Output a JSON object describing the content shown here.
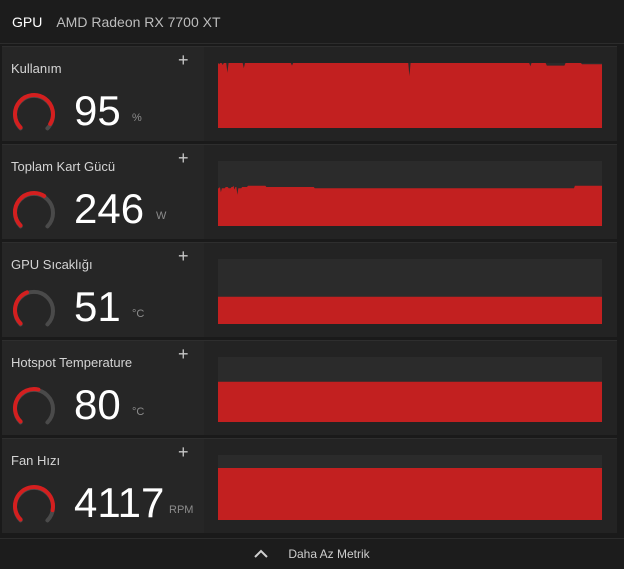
{
  "header": {
    "tab_label": "GPU",
    "device_name": "AMD Radeon RX 7700 XT"
  },
  "colors": {
    "accent": "#d41f1f",
    "graph_fill": "#c22020",
    "gauge_track": "#4a4a4a"
  },
  "metrics": [
    {
      "name": "Kullanım",
      "value": "95",
      "unit": "%",
      "gauge_fraction": 0.95,
      "history": [
        100,
        98,
        100,
        100,
        97,
        100,
        100,
        100,
        85,
        100,
        100,
        100,
        100,
        100,
        100,
        100,
        100,
        100,
        100,
        100,
        100,
        100,
        92,
        100,
        100,
        100,
        100,
        100,
        100,
        100,
        100,
        100,
        100,
        100,
        100,
        100,
        100,
        100,
        100,
        100,
        100,
        100,
        100,
        100,
        100,
        100,
        100,
        100,
        100,
        100,
        100,
        100,
        100,
        100,
        100,
        100,
        100,
        100,
        100,
        100,
        100,
        100,
        100,
        96,
        100,
        100,
        100,
        100,
        100,
        100,
        100,
        100,
        100,
        100,
        100,
        100,
        100,
        100,
        100,
        100,
        100,
        100,
        100,
        100,
        100,
        100,
        100,
        100,
        100,
        100,
        100,
        100,
        100,
        100,
        100,
        100,
        100,
        100,
        100,
        100,
        100,
        100,
        100,
        100,
        100,
        100,
        100,
        100,
        100,
        100,
        100,
        100,
        100,
        100,
        100,
        100,
        100,
        100,
        100,
        100,
        100,
        100,
        100,
        100,
        100,
        100,
        100,
        100,
        100,
        100,
        100,
        100,
        100,
        100,
        100,
        100,
        100,
        100,
        100,
        100,
        100,
        100,
        100,
        100,
        100,
        100,
        100,
        100,
        100,
        100,
        100,
        100,
        100,
        100,
        100,
        100,
        100,
        100,
        100,
        100,
        100,
        100,
        100,
        80,
        100,
        100,
        100,
        100,
        100,
        100,
        100,
        100,
        100,
        100,
        100,
        100,
        100,
        100,
        100,
        100,
        100,
        100,
        100,
        100,
        100,
        100,
        100,
        100,
        100,
        100,
        100,
        100,
        100,
        100,
        100,
        100,
        100,
        100,
        100,
        100,
        100,
        100,
        100,
        100,
        100,
        100,
        100,
        100,
        100,
        100,
        100,
        100,
        100,
        100,
        100,
        100,
        100,
        100,
        100,
        100,
        100,
        100,
        100,
        100,
        100,
        100,
        100,
        100,
        100,
        100,
        100,
        100,
        100,
        100,
        100,
        100,
        100,
        100,
        100,
        100,
        100,
        100,
        100,
        100,
        100,
        100,
        100,
        100,
        100,
        100,
        100,
        100,
        100,
        100,
        100,
        100,
        100,
        100,
        100,
        100,
        100,
        100,
        100,
        100,
        100,
        100,
        95,
        100,
        100,
        100,
        100,
        100,
        100,
        100,
        100,
        100,
        100,
        100,
        100,
        100,
        96,
        96,
        96,
        96,
        96,
        96,
        96,
        96,
        96,
        96,
        96,
        96,
        96,
        96,
        96,
        96,
        100,
        100,
        100,
        100,
        100,
        100,
        100,
        100,
        100,
        100,
        100,
        100,
        100,
        100,
        98,
        98,
        98,
        98,
        98,
        98,
        98,
        98,
        98,
        98,
        98,
        98,
        98,
        98,
        98,
        98,
        98,
        98
      ]
    },
    {
      "name": "Toplam Kart Gücü",
      "value": "246",
      "unit": "W",
      "gauge_fraction": 0.62,
      "history": [
        58,
        58,
        60,
        52,
        58,
        58,
        58,
        58,
        60,
        60,
        60,
        58,
        58,
        58,
        60,
        60,
        62,
        56,
        60,
        60,
        48,
        58,
        58,
        58,
        58,
        60,
        60,
        60,
        60,
        60,
        60,
        62,
        62,
        62,
        62,
        62,
        62,
        62,
        62,
        62,
        62,
        62,
        62,
        62,
        62,
        62,
        62,
        62,
        62,
        62,
        60,
        60,
        60,
        60,
        60,
        60,
        60,
        60,
        60,
        60,
        60,
        60,
        60,
        60,
        60,
        60,
        60,
        60,
        60,
        60,
        60,
        60,
        60,
        60,
        60,
        60,
        60,
        60,
        60,
        60,
        60,
        60,
        60,
        60,
        60,
        60,
        60,
        60,
        60,
        60,
        60,
        60,
        60,
        60,
        60,
        60,
        60,
        60,
        60,
        60,
        58,
        58,
        58,
        58,
        58,
        58,
        58,
        58,
        58,
        58,
        58,
        58,
        58,
        58,
        58,
        58,
        58,
        58,
        58,
        58,
        58,
        58,
        58,
        58,
        58,
        58,
        58,
        58,
        58,
        58,
        58,
        58,
        58,
        58,
        58,
        58,
        58,
        58,
        58,
        58,
        58,
        58,
        58,
        58,
        58,
        58,
        58,
        58,
        58,
        58,
        58,
        58,
        58,
        58,
        58,
        58,
        58,
        58,
        58,
        58,
        58,
        58,
        58,
        58,
        58,
        58,
        58,
        58,
        58,
        58,
        58,
        58,
        58,
        58,
        58,
        58,
        58,
        58,
        58,
        58,
        58,
        58,
        58,
        58,
        58,
        58,
        58,
        58,
        58,
        58,
        58,
        58,
        58,
        58,
        58,
        58,
        58,
        58,
        58,
        58,
        58,
        58,
        58,
        58,
        58,
        58,
        58,
        58,
        58,
        58,
        58,
        58,
        58,
        58,
        58,
        58,
        58,
        58,
        58,
        58,
        58,
        58,
        58,
        58,
        58,
        58,
        58,
        58,
        58,
        58,
        58,
        58,
        58,
        58,
        58,
        58,
        58,
        58,
        58,
        58,
        58,
        58,
        58,
        58,
        58,
        58,
        58,
        58,
        58,
        58,
        58,
        58,
        58,
        58,
        58,
        58,
        58,
        58,
        58,
        58,
        58,
        58,
        58,
        58,
        58,
        58,
        58,
        58,
        58,
        58,
        58,
        58,
        58,
        58,
        58,
        58,
        58,
        58,
        58,
        58,
        58,
        58,
        58,
        58,
        58,
        58,
        58,
        58,
        58,
        58,
        58,
        58,
        58,
        58,
        58,
        58,
        58,
        58,
        58,
        58,
        58,
        58,
        58,
        58,
        58,
        58,
        58,
        58,
        58,
        58,
        58,
        58,
        58,
        58,
        58,
        58,
        58,
        58,
        58,
        58,
        58,
        58,
        58,
        58,
        58,
        58,
        58,
        58,
        58,
        58,
        58,
        58,
        58,
        58,
        58,
        58,
        58,
        58,
        58,
        58,
        58,
        58,
        58,
        58,
        58,
        58,
        58,
        58,
        58,
        58,
        58,
        58,
        58,
        58,
        58,
        58,
        58,
        58,
        58,
        58,
        58,
        58,
        58,
        58,
        58,
        58,
        58,
        58,
        58,
        62,
        62,
        62,
        62,
        62,
        62,
        62,
        62,
        62,
        62,
        62,
        62,
        62,
        62,
        62,
        62,
        62,
        62,
        62,
        62,
        62,
        62,
        62,
        62,
        62,
        62,
        62,
        62,
        62
      ]
    },
    {
      "name": "GPU Sıcaklığı",
      "value": "51",
      "unit": "°C",
      "gauge_fraction": 0.42,
      "history": [
        42
      ]
    },
    {
      "name": "Hotspot Temperature",
      "value": "80",
      "unit": "°C",
      "gauge_fraction": 0.55,
      "history": [
        62
      ]
    },
    {
      "name": "Fan Hızı",
      "value": "4117",
      "unit": "RPM",
      "gauge_fraction": 0.88,
      "history": [
        80
      ]
    }
  ],
  "footer": {
    "label": "Daha Az Metrik"
  }
}
